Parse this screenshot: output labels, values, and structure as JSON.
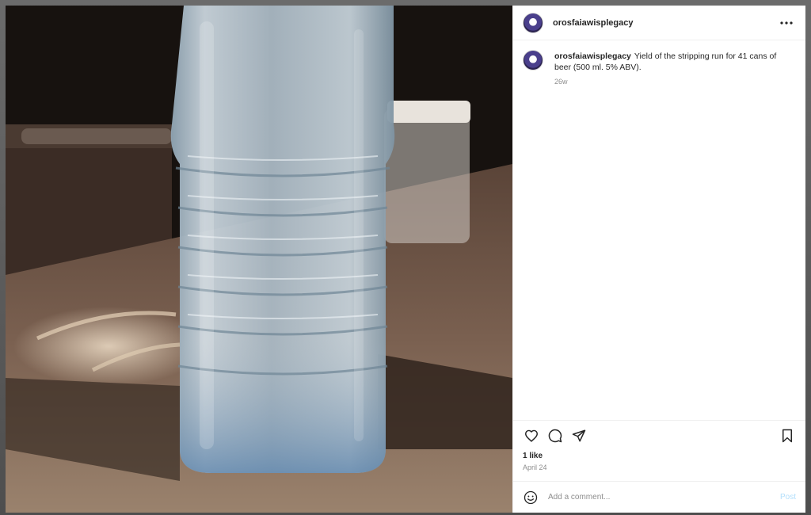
{
  "post": {
    "username": "orosfaiawisplegacy",
    "caption": "Yield of the stripping run for 41 cans of beer (500 ml. 5% ABV).",
    "time_ago": "26w",
    "likes": "1 like",
    "date": "April 24",
    "photo_description_icon": "water-bottle-photo"
  },
  "comment": {
    "placeholder": "Add a comment...",
    "post_label": "Post"
  },
  "icons": {
    "more": "more-icon",
    "like": "heart-icon",
    "comment": "comment-icon",
    "share": "share-icon",
    "save": "bookmark-icon",
    "emoji": "emoji-icon"
  },
  "colors": {
    "post_button": "#b2dffc",
    "muted_text": "#8e8e8e",
    "text": "#262626"
  }
}
